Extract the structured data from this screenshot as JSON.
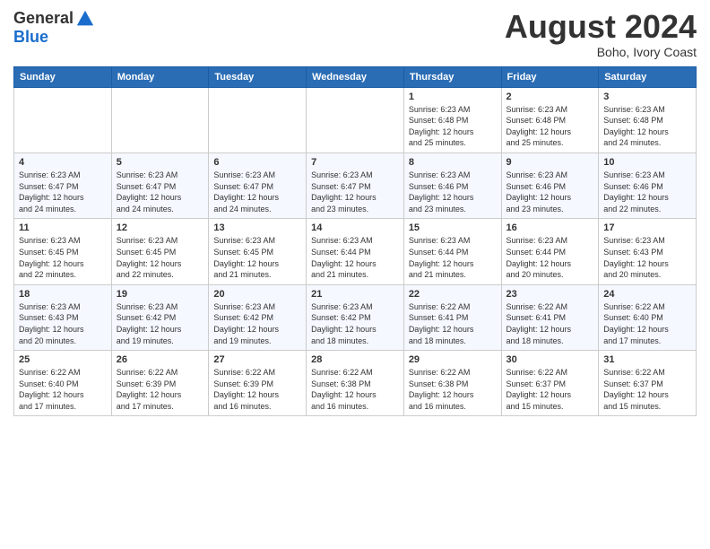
{
  "header": {
    "logo_line1": "General",
    "logo_line2": "Blue",
    "month_title": "August 2024",
    "location": "Boho, Ivory Coast"
  },
  "days_of_week": [
    "Sunday",
    "Monday",
    "Tuesday",
    "Wednesday",
    "Thursday",
    "Friday",
    "Saturday"
  ],
  "weeks": [
    [
      {
        "day": "",
        "info": ""
      },
      {
        "day": "",
        "info": ""
      },
      {
        "day": "",
        "info": ""
      },
      {
        "day": "",
        "info": ""
      },
      {
        "day": "1",
        "info": "Sunrise: 6:23 AM\nSunset: 6:48 PM\nDaylight: 12 hours\nand 25 minutes."
      },
      {
        "day": "2",
        "info": "Sunrise: 6:23 AM\nSunset: 6:48 PM\nDaylight: 12 hours\nand 25 minutes."
      },
      {
        "day": "3",
        "info": "Sunrise: 6:23 AM\nSunset: 6:48 PM\nDaylight: 12 hours\nand 24 minutes."
      }
    ],
    [
      {
        "day": "4",
        "info": "Sunrise: 6:23 AM\nSunset: 6:47 PM\nDaylight: 12 hours\nand 24 minutes."
      },
      {
        "day": "5",
        "info": "Sunrise: 6:23 AM\nSunset: 6:47 PM\nDaylight: 12 hours\nand 24 minutes."
      },
      {
        "day": "6",
        "info": "Sunrise: 6:23 AM\nSunset: 6:47 PM\nDaylight: 12 hours\nand 24 minutes."
      },
      {
        "day": "7",
        "info": "Sunrise: 6:23 AM\nSunset: 6:47 PM\nDaylight: 12 hours\nand 23 minutes."
      },
      {
        "day": "8",
        "info": "Sunrise: 6:23 AM\nSunset: 6:46 PM\nDaylight: 12 hours\nand 23 minutes."
      },
      {
        "day": "9",
        "info": "Sunrise: 6:23 AM\nSunset: 6:46 PM\nDaylight: 12 hours\nand 23 minutes."
      },
      {
        "day": "10",
        "info": "Sunrise: 6:23 AM\nSunset: 6:46 PM\nDaylight: 12 hours\nand 22 minutes."
      }
    ],
    [
      {
        "day": "11",
        "info": "Sunrise: 6:23 AM\nSunset: 6:45 PM\nDaylight: 12 hours\nand 22 minutes."
      },
      {
        "day": "12",
        "info": "Sunrise: 6:23 AM\nSunset: 6:45 PM\nDaylight: 12 hours\nand 22 minutes."
      },
      {
        "day": "13",
        "info": "Sunrise: 6:23 AM\nSunset: 6:45 PM\nDaylight: 12 hours\nand 21 minutes."
      },
      {
        "day": "14",
        "info": "Sunrise: 6:23 AM\nSunset: 6:44 PM\nDaylight: 12 hours\nand 21 minutes."
      },
      {
        "day": "15",
        "info": "Sunrise: 6:23 AM\nSunset: 6:44 PM\nDaylight: 12 hours\nand 21 minutes."
      },
      {
        "day": "16",
        "info": "Sunrise: 6:23 AM\nSunset: 6:44 PM\nDaylight: 12 hours\nand 20 minutes."
      },
      {
        "day": "17",
        "info": "Sunrise: 6:23 AM\nSunset: 6:43 PM\nDaylight: 12 hours\nand 20 minutes."
      }
    ],
    [
      {
        "day": "18",
        "info": "Sunrise: 6:23 AM\nSunset: 6:43 PM\nDaylight: 12 hours\nand 20 minutes."
      },
      {
        "day": "19",
        "info": "Sunrise: 6:23 AM\nSunset: 6:42 PM\nDaylight: 12 hours\nand 19 minutes."
      },
      {
        "day": "20",
        "info": "Sunrise: 6:23 AM\nSunset: 6:42 PM\nDaylight: 12 hours\nand 19 minutes."
      },
      {
        "day": "21",
        "info": "Sunrise: 6:23 AM\nSunset: 6:42 PM\nDaylight: 12 hours\nand 18 minutes."
      },
      {
        "day": "22",
        "info": "Sunrise: 6:22 AM\nSunset: 6:41 PM\nDaylight: 12 hours\nand 18 minutes."
      },
      {
        "day": "23",
        "info": "Sunrise: 6:22 AM\nSunset: 6:41 PM\nDaylight: 12 hours\nand 18 minutes."
      },
      {
        "day": "24",
        "info": "Sunrise: 6:22 AM\nSunset: 6:40 PM\nDaylight: 12 hours\nand 17 minutes."
      }
    ],
    [
      {
        "day": "25",
        "info": "Sunrise: 6:22 AM\nSunset: 6:40 PM\nDaylight: 12 hours\nand 17 minutes."
      },
      {
        "day": "26",
        "info": "Sunrise: 6:22 AM\nSunset: 6:39 PM\nDaylight: 12 hours\nand 17 minutes."
      },
      {
        "day": "27",
        "info": "Sunrise: 6:22 AM\nSunset: 6:39 PM\nDaylight: 12 hours\nand 16 minutes."
      },
      {
        "day": "28",
        "info": "Sunrise: 6:22 AM\nSunset: 6:38 PM\nDaylight: 12 hours\nand 16 minutes."
      },
      {
        "day": "29",
        "info": "Sunrise: 6:22 AM\nSunset: 6:38 PM\nDaylight: 12 hours\nand 16 minutes."
      },
      {
        "day": "30",
        "info": "Sunrise: 6:22 AM\nSunset: 6:37 PM\nDaylight: 12 hours\nand 15 minutes."
      },
      {
        "day": "31",
        "info": "Sunrise: 6:22 AM\nSunset: 6:37 PM\nDaylight: 12 hours\nand 15 minutes."
      }
    ]
  ]
}
